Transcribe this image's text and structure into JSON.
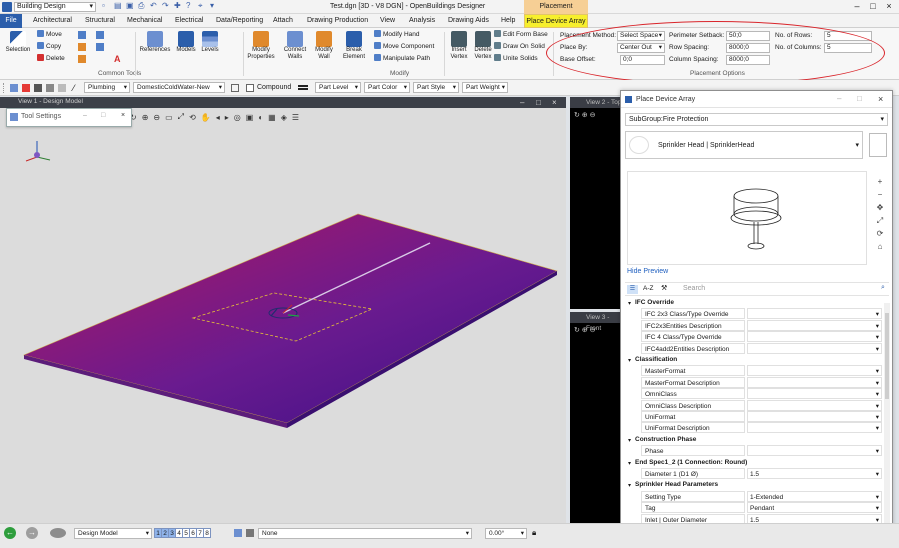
{
  "app": {
    "workspace": "Building Design",
    "doc_title": "Test.dgn [3D - V8 DGN] - OpenBuildings Designer",
    "context_tab_group": "Placement"
  },
  "tabs": [
    "File",
    "Architectural",
    "Structural",
    "Mechanical",
    "Electrical",
    "Data/Reporting",
    "Attach",
    "Drawing Production",
    "View",
    "Analysis",
    "Drawing Aids",
    "Help",
    "Place Device Array"
  ],
  "ribbon": {
    "selection": "Selection",
    "move": "Move",
    "copy": "Copy",
    "delete": "Delete",
    "references": "References",
    "models": "Models",
    "levels": "Levels",
    "modify_properties": "Modify\nProperties",
    "connect_walls": "Connect\nWalls",
    "modify_wall": "Modify\nWall",
    "break_element": "Break\nElement",
    "modify_hand": "Modify Hand",
    "move_component": "Move Component",
    "manipulate_path": "Manipulate Path",
    "insert_vertex": "Insert\nVertex",
    "delete_vertex": "Delete\nVertex",
    "edit_form_base": "Edit Form Base",
    "draw_on_solid": "Draw On Solid",
    "unite_solids": "Unite Solids",
    "group_common": "Common Tools",
    "group_modify": "Modify",
    "group_placement": "Placement Options"
  },
  "placement": {
    "method_label": "Placement Method:",
    "method_value": "Select Space",
    "place_by_label": "Place By:",
    "place_by_value": "Center Out",
    "base_offset_label": "Base Offset:",
    "base_offset_value": "0;0",
    "perimeter_label": "Perimeter Setback:",
    "perimeter_value": "50;0",
    "row_spacing_label": "Row Spacing:",
    "row_spacing_value": "8000;0",
    "col_spacing_label": "Column Spacing:",
    "col_spacing_value": "8000;0",
    "rows_label": "No. of Rows:",
    "rows_value": "5",
    "cols_label": "No. of Columns:",
    "cols_value": "5"
  },
  "attrbar": {
    "discipline": "Plumbing",
    "system": "DomesticColdWater-New",
    "compound": "Compound",
    "part_level": "Part Level",
    "part_color": "Part Color",
    "part_style": "Part Style",
    "part_weight": "Part Weight"
  },
  "views": {
    "view1": "View 1 - Design Model",
    "view2": "View 2 - Top",
    "view3": "View 3 - Front",
    "tool_settings": "Tool Settings"
  },
  "panel": {
    "title": "Place Device Array",
    "subgroup": "SubGroup:Fire Protection",
    "device": "Sprinkler Head | SprinklerHead",
    "hide_preview": "Hide Preview",
    "search_placeholder": "Search",
    "sections": [
      {
        "name": "IFC Override",
        "rows": [
          [
            "IFC 2x3 Class/Type Override",
            ""
          ],
          [
            "IFC2x3Entities Description",
            ""
          ],
          [
            "IFC 4 Class/Type Override",
            ""
          ],
          [
            "IFC4add2Entities Description",
            ""
          ]
        ]
      },
      {
        "name": "Classification",
        "rows": [
          [
            "MasterFormat",
            ""
          ],
          [
            "MasterFormat Description",
            ""
          ],
          [
            "OmniClass",
            ""
          ],
          [
            "OmniClass Description",
            ""
          ],
          [
            "UniFormat",
            ""
          ],
          [
            "UniFormat Description",
            ""
          ]
        ]
      },
      {
        "name": "Construction Phase",
        "rows": [
          [
            "Phase",
            ""
          ]
        ]
      },
      {
        "name": "End Spec1_2 (1 Connection: Round)",
        "rows": [
          [
            "Diameter 1 (D1 Ø)",
            "1.5"
          ]
        ]
      },
      {
        "name": "Sprinkler Head Parameters",
        "rows": [
          [
            "Setting Type",
            "1-Extended"
          ],
          [
            "Tag",
            "Pendant"
          ],
          [
            "Inlet | Outer Diameter",
            "1.5"
          ],
          [
            "Height",
            "4.5"
          ]
        ]
      }
    ]
  },
  "statusbar": {
    "model": "Design Model",
    "views": [
      "1",
      "2",
      "3",
      "4",
      "5",
      "6",
      "7",
      "8"
    ],
    "level": "None",
    "angle": "0.00°"
  },
  "colors": {
    "file_tab": "#2b5eab",
    "context_tab": "#f7ef2d",
    "slab_a": "#c2185b",
    "slab_b": "#4a148c",
    "annotation": "#d9262c"
  }
}
